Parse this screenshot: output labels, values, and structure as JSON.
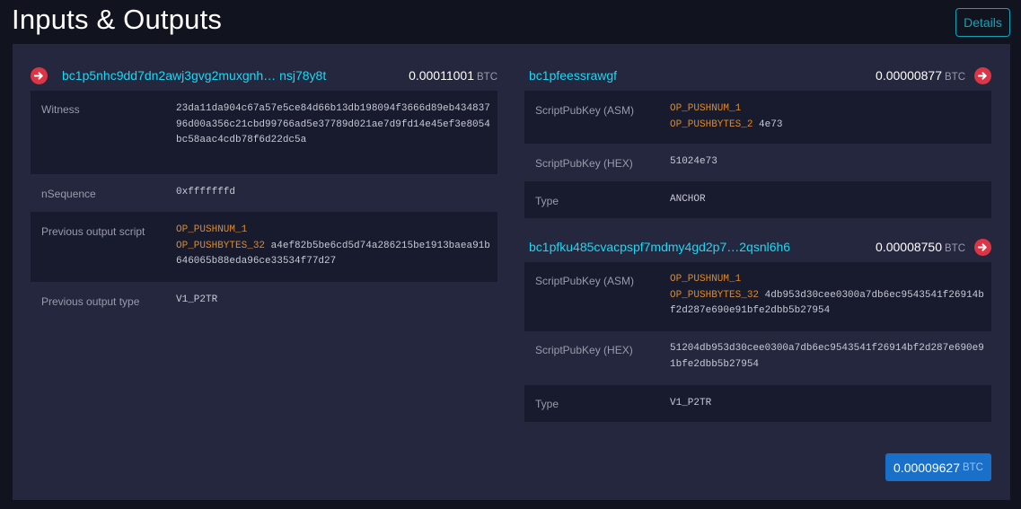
{
  "page": {
    "title": "Inputs & Outputs",
    "details_label": "Details"
  },
  "inputs": [
    {
      "address": "bc1p5nhc9dd7dn2awj3gvg2muxgnh… nsj78y8t",
      "amount": "0.00011001",
      "unit": "BTC",
      "witness_label": "Witness",
      "witness": "23da11da904c67a57e5ce84d66b13db198094f3666d89eb43483796d00a356c21cbd99766ad5e37789d021ae7d9fd14e45ef3e8054bc58aac4cdb78f6d22dc5a",
      "nsequence_label": "nSequence",
      "nsequence": "0xfffffffd",
      "prev_script_label": "Previous output script",
      "prev_script_op1": "OP_PUSHNUM_1",
      "prev_script_op2": "OP_PUSHBYTES_32",
      "prev_script_data": "a4ef82b5be6cd5d74a286215be1913baea91b646065b88eda96ce33534f77d27",
      "prev_type_label": "Previous output type",
      "prev_type": "V1_P2TR"
    }
  ],
  "outputs": [
    {
      "address": "bc1pfeessrawgf",
      "amount": "0.00000877",
      "unit": "BTC",
      "asm_label": "ScriptPubKey (ASM)",
      "asm_op1": "OP_PUSHNUM_1",
      "asm_op2": "OP_PUSHBYTES_2",
      "asm_data": "4e73",
      "hex_label": "ScriptPubKey (HEX)",
      "hex": "51024e73",
      "type_label": "Type",
      "type": "ANCHOR"
    },
    {
      "address": "bc1pfku485cvacpspf7mdmy4gd2p7…2qsnl6h6",
      "amount": "0.00008750",
      "unit": "BTC",
      "asm_label": "ScriptPubKey (ASM)",
      "asm_op1": "OP_PUSHNUM_1",
      "asm_op2": "OP_PUSHBYTES_32",
      "asm_data": "4db953d30cee0300a7db6ec9543541f26914bf2d287e690e91bfe2dbb5b27954",
      "hex_label": "ScriptPubKey (HEX)",
      "hex": "51204db953d30cee0300a7db6ec9543541f26914bf2d287e690e91bfe2dbb5b27954",
      "type_label": "Type",
      "type": "V1_P2TR"
    }
  ],
  "total": {
    "amount": "0.00009627",
    "unit": "BTC"
  },
  "colors": {
    "address": "#1bd8f4",
    "arrow": "#dc3545",
    "opcode": "#e18929",
    "total_bg": "#1a6fc9",
    "details_border": "#17a2b8"
  },
  "icons": {
    "input_arrow": "arrow-right-circle-icon",
    "output_arrow": "arrow-right-circle-icon"
  }
}
